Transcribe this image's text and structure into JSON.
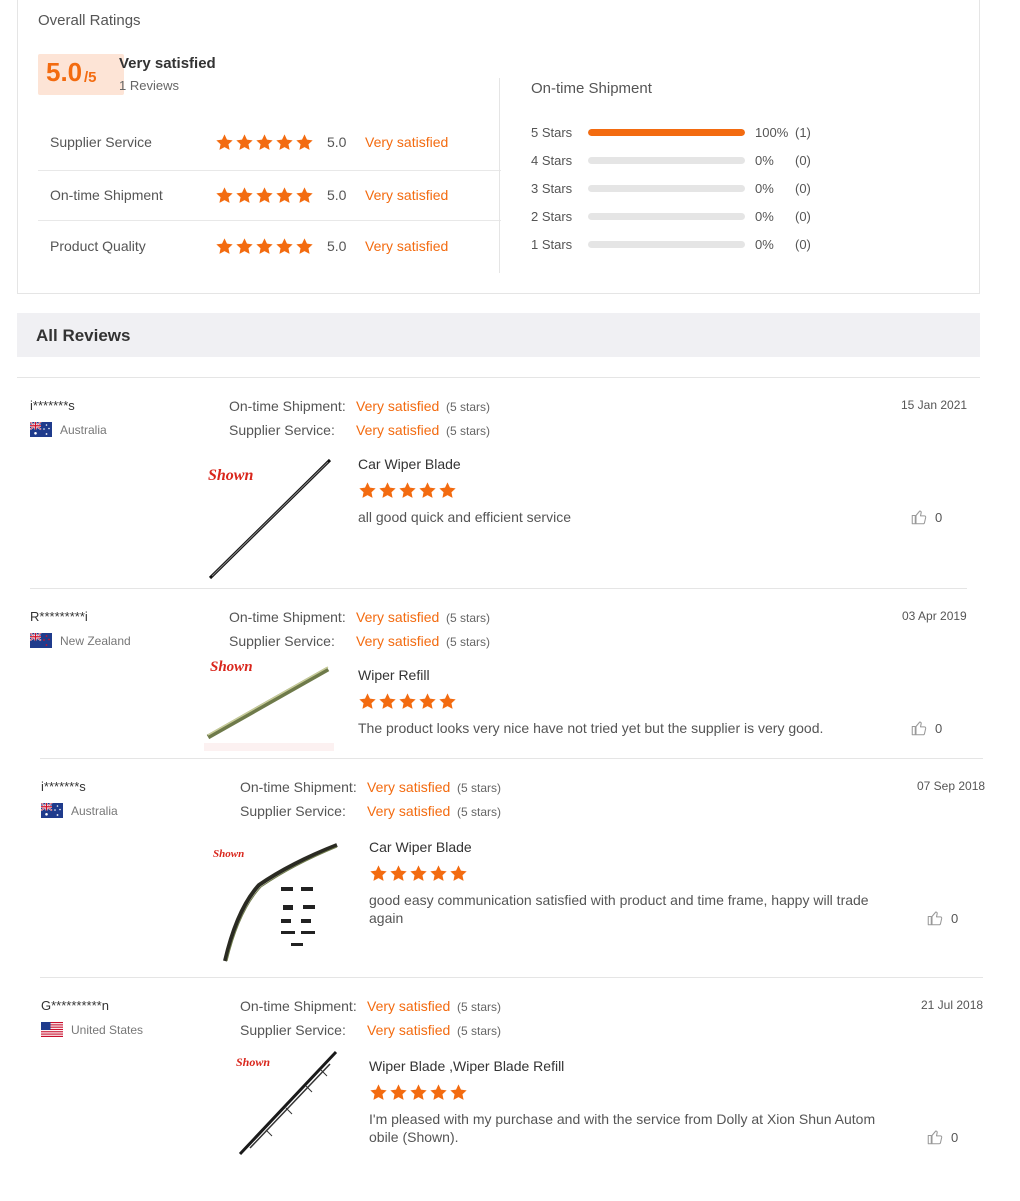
{
  "overall": {
    "title": "Overall Ratings",
    "score": "5.0",
    "score_max": "/5",
    "summary": "Very satisfied",
    "review_count": "1 Reviews",
    "categories": [
      {
        "label": "Supplier Service",
        "stars": 5,
        "score": "5.0",
        "satisfaction": "Very satisfied"
      },
      {
        "label": "On-time Shipment",
        "stars": 5,
        "score": "5.0",
        "satisfaction": "Very satisfied"
      },
      {
        "label": "Product Quality",
        "stars": 5,
        "score": "5.0",
        "satisfaction": "Very satisfied"
      }
    ]
  },
  "shipment": {
    "title": "On-time Shipment",
    "bars": [
      {
        "label": "5 Stars",
        "fraction": 1.0,
        "pct": "100%",
        "count": "(1)"
      },
      {
        "label": "4 Stars",
        "fraction": 0,
        "pct": "0%",
        "count": "(0)"
      },
      {
        "label": "3 Stars",
        "fraction": 0,
        "pct": "0%",
        "count": "(0)"
      },
      {
        "label": "2 Stars",
        "fraction": 0,
        "pct": "0%",
        "count": "(0)"
      },
      {
        "label": "1 Stars",
        "fraction": 0,
        "pct": "0%",
        "count": "(0)"
      }
    ]
  },
  "all_reviews": {
    "title": "All Reviews"
  },
  "reviews": [
    {
      "user": "i*******s",
      "country": "Australia",
      "flag": "au",
      "shipment_label": "On-time Shipment:",
      "shipment_sat": "Very satisfied",
      "shipment_stars": "(5 stars)",
      "service_label": "Supplier Service:",
      "service_sat": "Very satisfied",
      "service_stars": "(5 stars)",
      "date": "15 Jan 2021",
      "product": "Car Wiper Blade",
      "rating": 5,
      "text": "all good quick and efficient service",
      "likes": "0"
    },
    {
      "user": "R*********i",
      "country": "New Zealand",
      "flag": "nz",
      "shipment_label": "On-time Shipment:",
      "shipment_sat": "Very satisfied",
      "shipment_stars": "(5 stars)",
      "service_label": "Supplier Service:",
      "service_sat": "Very satisfied",
      "service_stars": "(5 stars)",
      "date": "03 Apr 2019",
      "product": "Wiper Refill",
      "rating": 5,
      "text": "The product looks very nice have not tried yet but the supplier is very good.",
      "likes": "0"
    },
    {
      "user": "i*******s",
      "country": "Australia",
      "flag": "au",
      "shipment_label": "On-time Shipment:",
      "shipment_sat": "Very satisfied",
      "shipment_stars": "(5 stars)",
      "service_label": "Supplier Service:",
      "service_sat": "Very satisfied",
      "service_stars": "(5 stars)",
      "date": "07 Sep 2018",
      "product": "Car Wiper Blade",
      "rating": 5,
      "text": "good easy communication satisfied with product and time frame, happy will trade again",
      "likes": "0"
    },
    {
      "user": "G**********n",
      "country": "United States",
      "flag": "us",
      "shipment_label": "On-time Shipment:",
      "shipment_sat": "Very satisfied",
      "shipment_stars": "(5 stars)",
      "service_label": "Supplier Service:",
      "service_sat": "Very satisfied",
      "service_stars": "(5 stars)",
      "date": "21 Jul 2018",
      "product": "Wiper Blade ,Wiper Blade Refill",
      "rating": 5,
      "text": "I'm pleased with my purchase and with the service from Dolly at Xion Shun Autom obile (Shown).",
      "likes": "0"
    }
  ],
  "brand_logo_text": "Shown",
  "colors": {
    "accent": "#f36b10",
    "score_bg": "#fde4d6",
    "header_bg": "#f0f0f3",
    "track": "#e5e5e5"
  }
}
